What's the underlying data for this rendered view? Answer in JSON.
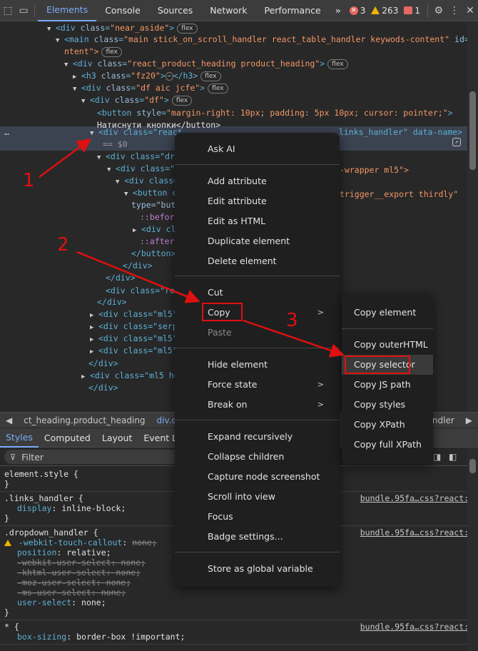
{
  "toolbar": {
    "tabs": [
      "Elements",
      "Console",
      "Sources",
      "Network",
      "Performance"
    ],
    "more": "»",
    "errors": "3",
    "warnings": "263",
    "issues": "1"
  },
  "tree": [
    {
      "pre": "      ",
      "arrow": "▼",
      "tag": "<div",
      "attrs": [
        [
          "class",
          "near_aside"
        ]
      ],
      "close": ">",
      "badge": "flex"
    },
    {
      "pre": "      ",
      "arrow": "▼",
      "tag": "<main",
      "attrs": [
        [
          "class",
          "main stick_on_scroll_handler react_table_handler keywods-content"
        ],
        [
          "id",
          "co"
        ]
      ],
      "close": "",
      "badge": ""
    },
    {
      "pre": "       ",
      "arrow": "",
      "tag": "",
      "attrs": [],
      "close": "",
      "badge": "flex",
      "text": "ntent\">"
    },
    {
      "pre": "        ",
      "arrow": "▼",
      "tag": "<div",
      "attrs": [
        [
          "class",
          "react_product_heading product_heading"
        ]
      ],
      "close": ">",
      "badge": "flex"
    },
    {
      "pre": "          ",
      "arrow": "▶",
      "tag": "<h3",
      "attrs": [
        [
          "class",
          "fz20"
        ]
      ],
      "close": ">…</h3>",
      "badge": "flex"
    },
    {
      "pre": "          ",
      "arrow": "▼",
      "tag": "<div",
      "attrs": [
        [
          "class",
          "df aic jcfe"
        ]
      ],
      "close": ">",
      "badge": "flex"
    },
    {
      "pre": "            ",
      "arrow": "▼",
      "tag": "<div",
      "attrs": [
        [
          "class",
          "df"
        ]
      ],
      "close": ">",
      "badge": "flex"
    },
    {
      "pre": "              ",
      "arrow": "",
      "tag": "<button",
      "attrs": [
        [
          "style",
          "margin-right: 10px; padding: 5px 10px; cursor: pointer;"
        ]
      ],
      "close": ">",
      "badge": ""
    },
    {
      "pre": "              ",
      "arrow": "",
      "tag": "",
      "attrs": [],
      "close": "",
      "badge": "",
      "text": "Натиснути кнопки</button>"
    }
  ],
  "selected_line": {
    "text_a": "<div class=\"react",
    "text_b": " links_handler\" data-name>",
    "text_c": "== $0"
  },
  "partial_lines": [
    "<div class=\"dro",
    "<div class=\"r",
    "<div class=",
    "<button c",
    "type=\"but",
    "::befor",
    "<div cl",
    "::after",
    "</button>",
    "</div>",
    "</div>",
    "<div class=\"rea",
    "</div>",
    "<div class=\"ml5\"",
    "<div class=\"serpa",
    "<div class=\"ml5\"",
    "<div class=\"ml5\"",
    "</div>",
    "<div class=\"ml5 he",
    "</div>"
  ],
  "right_fragments": {
    "wrapper": "-wrapper ml5\">",
    "export": "trigger__export thirdly\""
  },
  "breadcrumb": [
    "ct_heading.product_heading",
    "div.df.aic.j",
    "ndler"
  ],
  "styles_tabs": [
    "Styles",
    "Computed",
    "Layout",
    "Event Liste"
  ],
  "filter_placeholder": "Filter",
  "rules": [
    {
      "selector": "element.style {",
      "lines": [],
      "close": "}",
      "source": ""
    },
    {
      "selector": ".links_handler {",
      "lines": [
        [
          "display",
          "inline-block;",
          false,
          false
        ]
      ],
      "close": "}",
      "source": "bundle.95fa…css?react:1"
    },
    {
      "selector": ".dropdown_handler {",
      "lines": [
        [
          "-webkit-touch-callout",
          "none;",
          false,
          true
        ],
        [
          "position",
          "relative;",
          false,
          false
        ],
        [
          "-webkit-user-select",
          "none;",
          true,
          false
        ],
        [
          "-khtml-user-select",
          "none;",
          true,
          false
        ],
        [
          "-moz-user-select",
          "none;",
          true,
          false
        ],
        [
          "-ms-user-select",
          "none;",
          true,
          false
        ],
        [
          "user-select",
          "none;",
          false,
          false
        ]
      ],
      "close": "}",
      "source": "bundle.95fa…css?react:1"
    },
    {
      "selector": "* {",
      "lines": [
        [
          "box-sizing",
          "border-box !important;",
          false,
          false
        ]
      ],
      "close": "",
      "source": "bundle.95fa…css?react:1"
    }
  ],
  "context_menu": {
    "ask_ai": "Ask AI",
    "add_attribute": "Add attribute",
    "edit_attribute": "Edit attribute",
    "edit_html": "Edit as HTML",
    "duplicate": "Duplicate element",
    "delete": "Delete element",
    "cut": "Cut",
    "copy": "Copy",
    "paste": "Paste",
    "hide": "Hide element",
    "force_state": "Force state",
    "break_on": "Break on",
    "expand": "Expand recursively",
    "collapse": "Collapse children",
    "capture": "Capture node screenshot",
    "scroll": "Scroll into view",
    "focus": "Focus",
    "badge": "Badge settings...",
    "store": "Store as global variable"
  },
  "submenu": {
    "copy_element": "Copy element",
    "copy_outer": "Copy outerHTML",
    "copy_selector": "Copy selector",
    "copy_js": "Copy JS path",
    "copy_styles": "Copy styles",
    "copy_xpath": "Copy XPath",
    "copy_full_xpath": "Copy full XPath"
  },
  "annotations": {
    "n1": "1",
    "n2": "2",
    "n3": "3",
    "color": "#e01010"
  }
}
